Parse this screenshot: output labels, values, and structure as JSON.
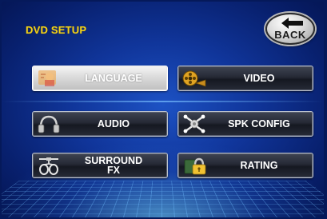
{
  "header": {
    "title": "DVD SETUP",
    "back_label": "BACK"
  },
  "menu": {
    "language": {
      "label": "LANGUAGE",
      "icon": "language-icon",
      "selected": true
    },
    "video": {
      "label": "VIDEO",
      "icon": "film-reel-icon"
    },
    "audio": {
      "label": "AUDIO",
      "icon": "headphones-icon"
    },
    "spk_config": {
      "label": "SPK CONFIG",
      "icon": "speaker-config-icon"
    },
    "surround": {
      "label": "SURROUND\nFX",
      "icon": "surround-icon"
    },
    "rating": {
      "label": "RATING",
      "icon": "lock-icon"
    }
  },
  "colors": {
    "title": "#f2d21b",
    "background": "#10359a",
    "button": "#252935",
    "selected_button": "#d8d8d8"
  }
}
